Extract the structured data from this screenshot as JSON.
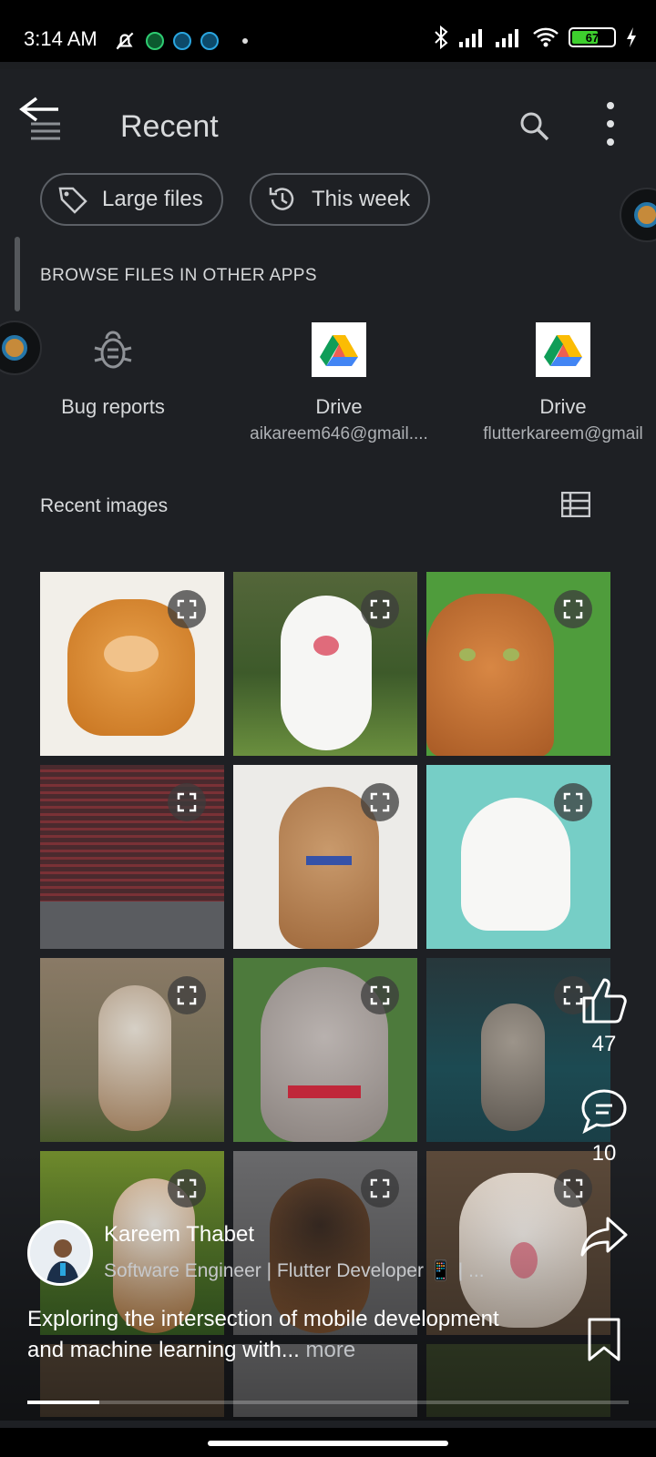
{
  "status_bar": {
    "time": "3:14 AM",
    "battery": "67",
    "battery_level": 0.67
  },
  "toolbar": {
    "title": "Recent"
  },
  "filters": [
    {
      "label": "Large files",
      "icon": "tag-icon"
    },
    {
      "label": "This week",
      "icon": "history-icon"
    }
  ],
  "browse": {
    "heading": "BROWSE FILES IN OTHER APPS",
    "apps": [
      {
        "label": "Bug reports",
        "subtitle": "",
        "icon": "bug-icon"
      },
      {
        "label": "Drive",
        "subtitle": "aikareem646@gmail....",
        "icon": "google-drive-icon"
      },
      {
        "label": "Drive",
        "subtitle": "flutterkareem@gmail",
        "icon": "google-drive-icon"
      }
    ]
  },
  "recent_images": {
    "heading": "Recent images",
    "items": [
      {
        "subject": "pomeranian-dog"
      },
      {
        "subject": "white-puppy"
      },
      {
        "subject": "orange-cat"
      },
      {
        "subject": "terminal-screenshot"
      },
      {
        "subject": "poodle-dog"
      },
      {
        "subject": "samoyed-puppy"
      },
      {
        "subject": "shepherd-dog"
      },
      {
        "subject": "weimaraner-dog"
      },
      {
        "subject": "tabby-cat"
      },
      {
        "subject": "beagle-dog"
      },
      {
        "subject": "puppy"
      },
      {
        "subject": "white-cat"
      }
    ]
  },
  "video_overlay": {
    "likes": "47",
    "comments": "10",
    "author": "Kareem Thabet",
    "author_subtitle": "Software Engineer | Flutter Developer 📱 | ...",
    "caption": "Exploring the intersection of mobile development and machine learning with...",
    "more_label": "more",
    "progress": 0.12
  },
  "colors": {
    "surface": "#1e2024",
    "text_primary": "#d8dadc",
    "chip_border": "#5c6066",
    "battery_green": "#3ecf2e"
  }
}
